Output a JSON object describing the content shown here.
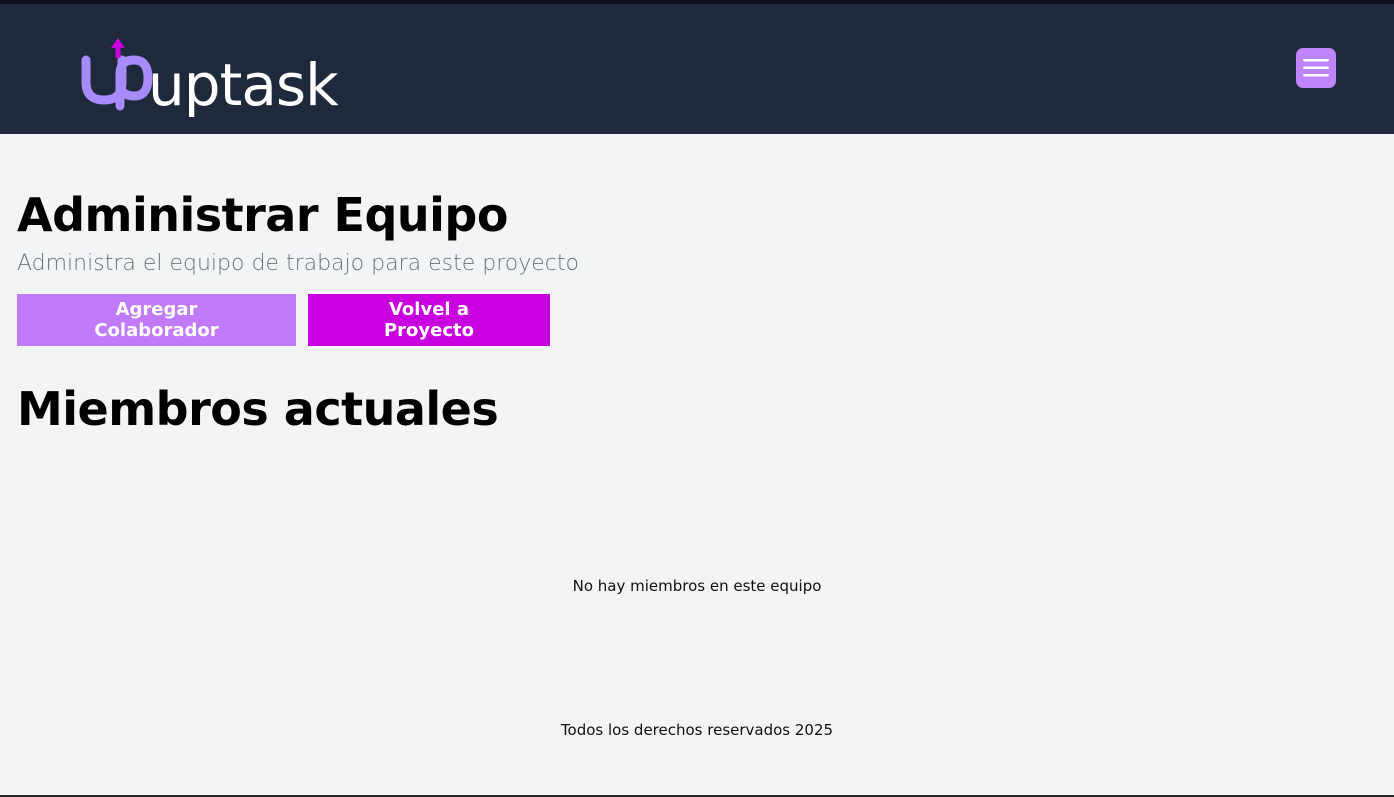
{
  "header": {
    "logo_text": "uptask",
    "menu_icon": "hamburger-menu-icon"
  },
  "main": {
    "title": "Administrar Equipo",
    "subtitle": "Administra el equipo de trabajo para este proyecto",
    "buttons": {
      "add_label": "Agregar Colaborador",
      "back_label": "Volvel a Proyecto"
    },
    "members_title": "Miembros actuales",
    "empty_message": "No hay miembros en este equipo"
  },
  "footer": {
    "text": "Todos los derechos reservados 2025"
  },
  "colors": {
    "header_bg": "#1e293b",
    "page_bg": "#f3f4f6",
    "accent_light": "#c17bfa",
    "accent_strong": "#c800e0"
  }
}
